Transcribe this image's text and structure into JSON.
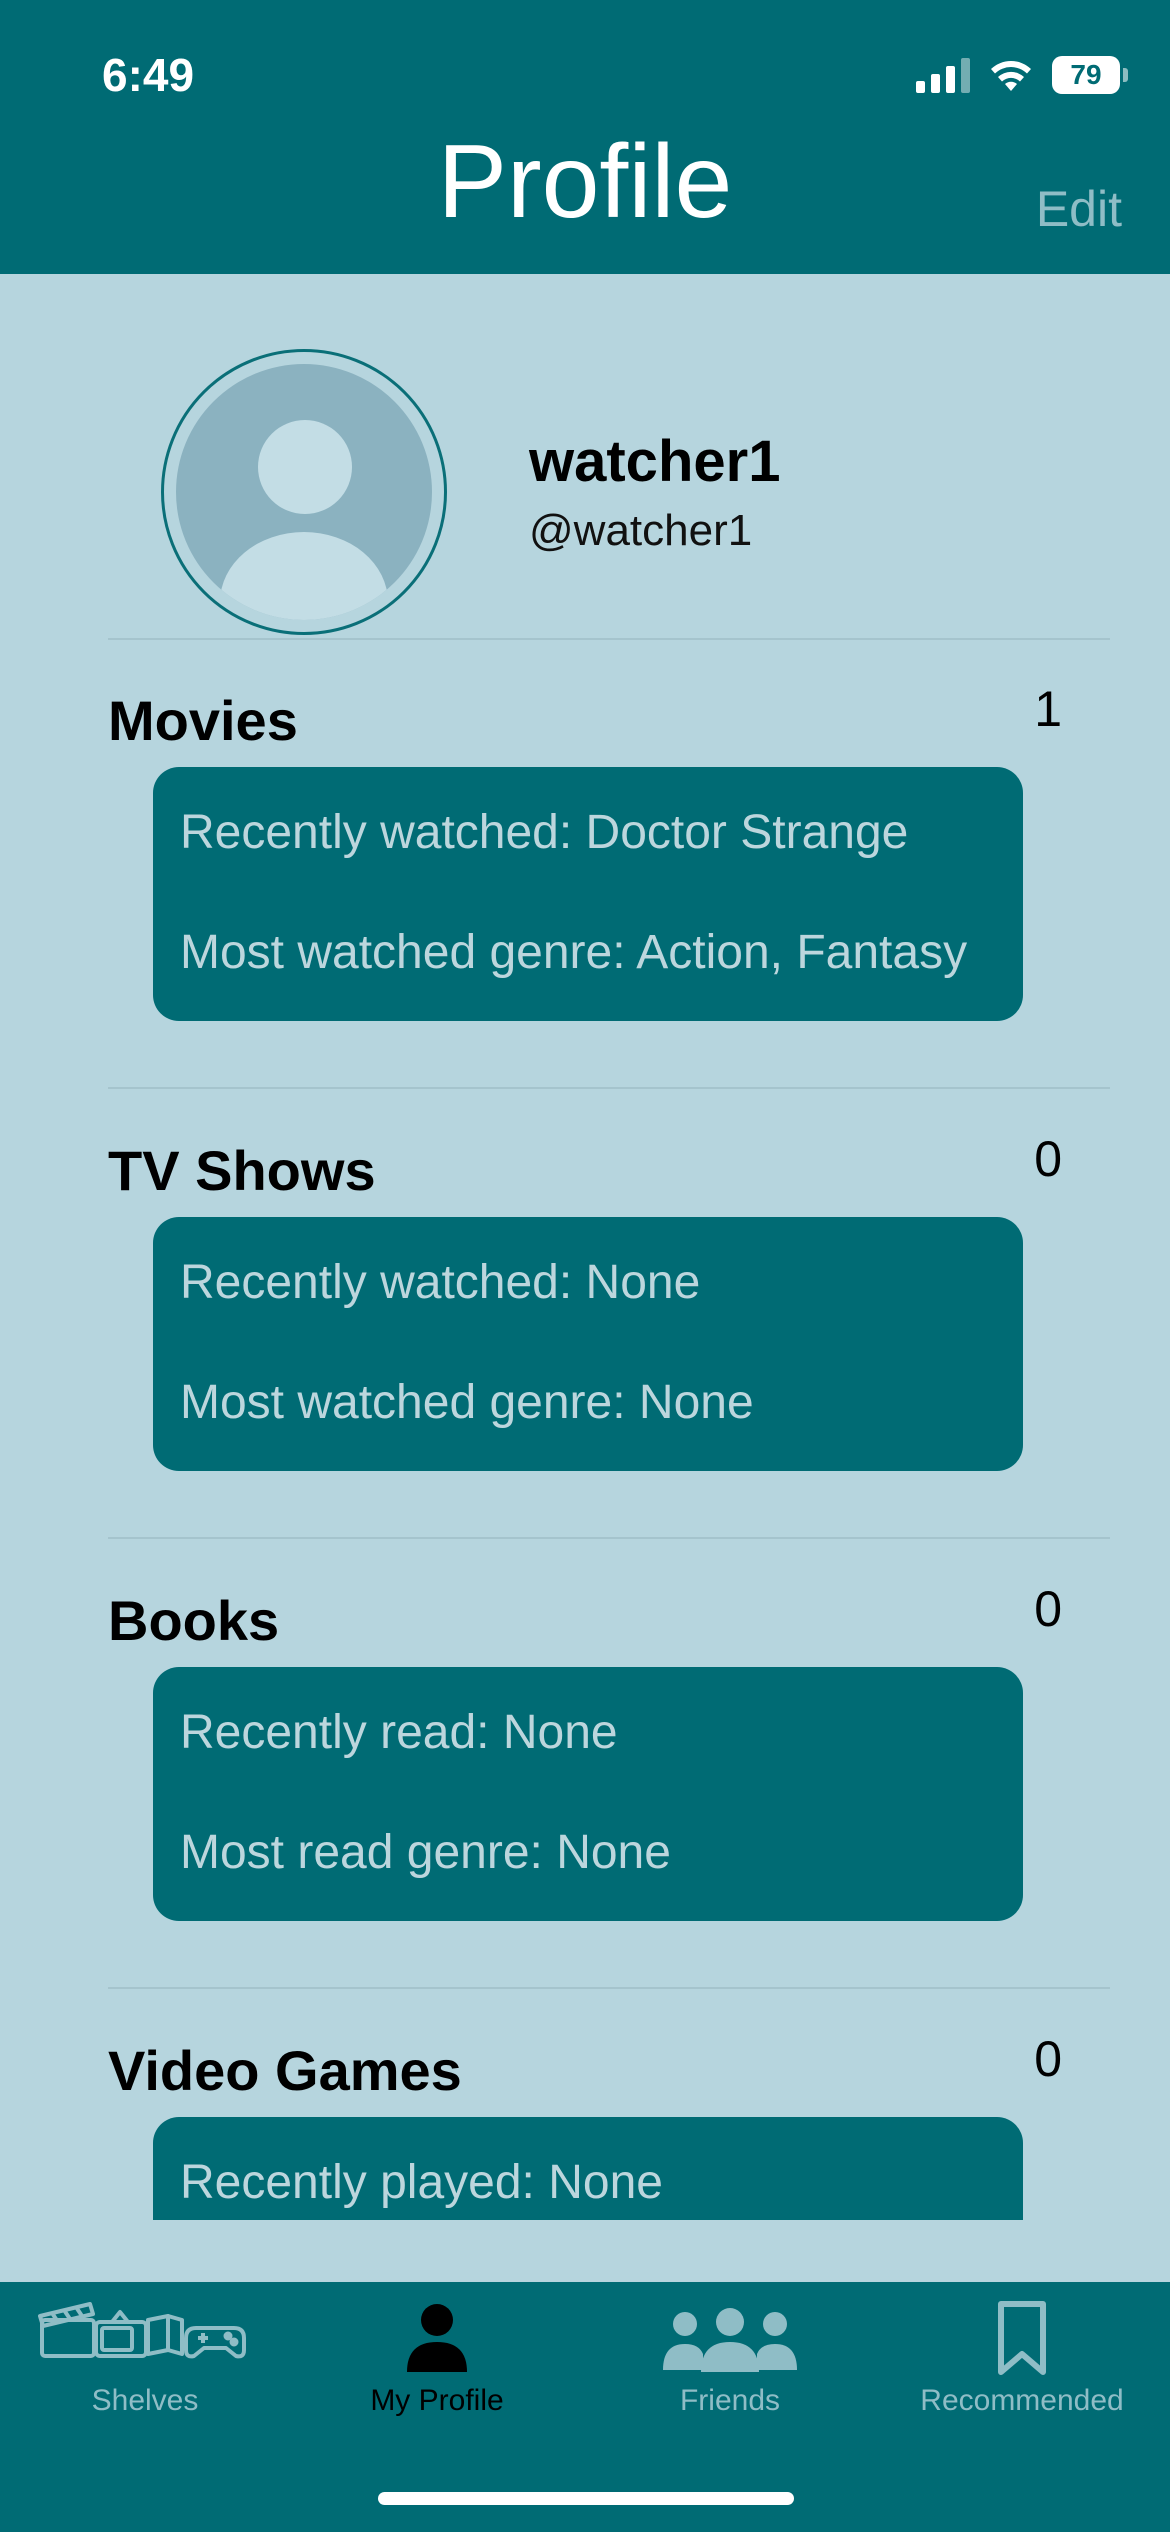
{
  "status_bar": {
    "time": "6:49",
    "battery": "79"
  },
  "header": {
    "title": "Profile",
    "edit_label": "Edit"
  },
  "profile": {
    "display_name": "watcher1",
    "handle": "@watcher1"
  },
  "sections": [
    {
      "title": "Movies",
      "count": "1",
      "line1": "Recently watched: Doctor Strange",
      "line2": "Most watched genre: Action, Fantasy"
    },
    {
      "title": "TV Shows",
      "count": "0",
      "line1": "Recently watched: None",
      "line2": "Most watched genre: None"
    },
    {
      "title": "Books",
      "count": "0",
      "line1": "Recently read: None",
      "line2": "Most read genre: None"
    },
    {
      "title": "Video Games",
      "count": "0",
      "line1": "Recently played: None",
      "line2": ""
    }
  ],
  "tabs": [
    {
      "label": "Shelves",
      "icon": "shelves-icon",
      "active": false
    },
    {
      "label": "My Profile",
      "icon": "person-icon",
      "active": true
    },
    {
      "label": "Friends",
      "icon": "friends-icon",
      "active": false
    },
    {
      "label": "Recommended",
      "icon": "bookmark-icon",
      "active": false
    }
  ],
  "colors": {
    "primary": "#006b74",
    "background": "#b6d5de",
    "card_text": "#bcd6dd",
    "inactive_tab": "#8fbdc6"
  }
}
